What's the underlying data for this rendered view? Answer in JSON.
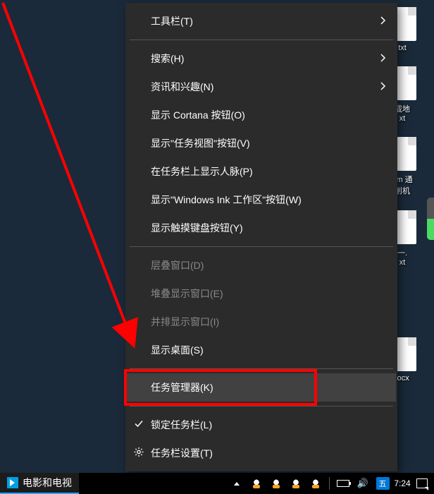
{
  "desktop": {
    "files": [
      {
        "label": "txt"
      },
      {
        "label": "载地\nxt"
      },
      {
        "label": "am 通\n削机"
      },
      {
        "label": "一.\nxt"
      },
      {
        "label": "locx"
      }
    ]
  },
  "menu": {
    "items": [
      {
        "label": "工具栏(T)",
        "submenu": true
      },
      {
        "label": "搜索(H)",
        "submenu": true
      },
      {
        "label": "资讯和兴趣(N)",
        "submenu": true
      },
      {
        "label": "显示 Cortana 按钮(O)"
      },
      {
        "label": "显示\"任务视图\"按钮(V)"
      },
      {
        "label": "在任务栏上显示人脉(P)"
      },
      {
        "label": "显示\"Windows Ink 工作区\"按钮(W)"
      },
      {
        "label": "显示触摸键盘按钮(Y)"
      },
      {
        "sep": true
      },
      {
        "label": "层叠窗口(D)",
        "disabled": true
      },
      {
        "label": "堆叠显示窗口(E)",
        "disabled": true
      },
      {
        "label": "并排显示窗口(I)",
        "disabled": true
      },
      {
        "label": "显示桌面(S)"
      },
      {
        "sep": true
      },
      {
        "label": "任务管理器(K)",
        "highlight": true,
        "hovered": true
      },
      {
        "sep": true
      },
      {
        "label": "锁定任务栏(L)",
        "checked": true
      },
      {
        "label": "任务栏设置(T)",
        "gear": true
      }
    ]
  },
  "taskbar": {
    "app": "电影和电视",
    "ime": "五",
    "clock": "7:24"
  }
}
